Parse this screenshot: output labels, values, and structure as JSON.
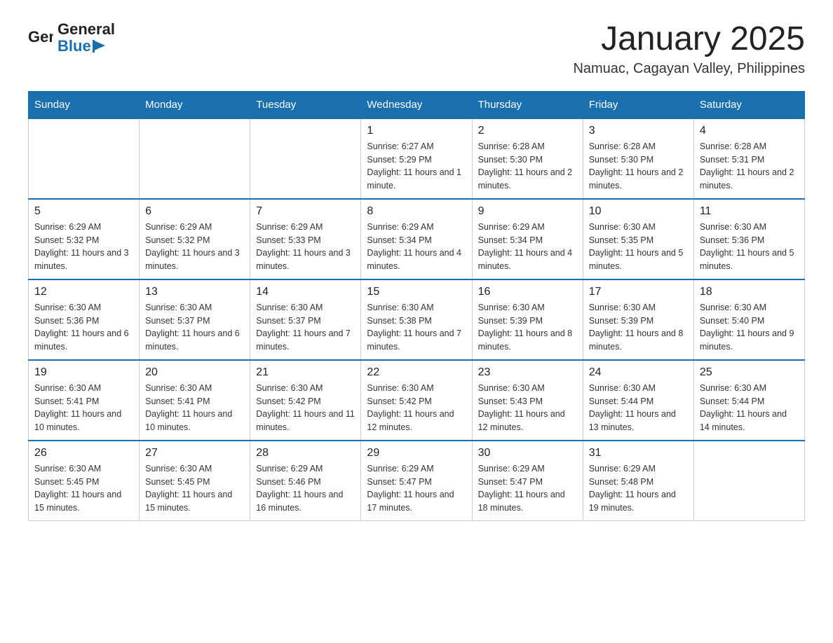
{
  "header": {
    "logo": {
      "text_general": "General",
      "text_blue": "Blue"
    },
    "title": "January 2025",
    "location": "Namuac, Cagayan Valley, Philippines"
  },
  "calendar": {
    "days_of_week": [
      "Sunday",
      "Monday",
      "Tuesday",
      "Wednesday",
      "Thursday",
      "Friday",
      "Saturday"
    ],
    "weeks": [
      [
        {
          "day": "",
          "info": ""
        },
        {
          "day": "",
          "info": ""
        },
        {
          "day": "",
          "info": ""
        },
        {
          "day": "1",
          "info": "Sunrise: 6:27 AM\nSunset: 5:29 PM\nDaylight: 11 hours and 1 minute."
        },
        {
          "day": "2",
          "info": "Sunrise: 6:28 AM\nSunset: 5:30 PM\nDaylight: 11 hours and 2 minutes."
        },
        {
          "day": "3",
          "info": "Sunrise: 6:28 AM\nSunset: 5:30 PM\nDaylight: 11 hours and 2 minutes."
        },
        {
          "day": "4",
          "info": "Sunrise: 6:28 AM\nSunset: 5:31 PM\nDaylight: 11 hours and 2 minutes."
        }
      ],
      [
        {
          "day": "5",
          "info": "Sunrise: 6:29 AM\nSunset: 5:32 PM\nDaylight: 11 hours and 3 minutes."
        },
        {
          "day": "6",
          "info": "Sunrise: 6:29 AM\nSunset: 5:32 PM\nDaylight: 11 hours and 3 minutes."
        },
        {
          "day": "7",
          "info": "Sunrise: 6:29 AM\nSunset: 5:33 PM\nDaylight: 11 hours and 3 minutes."
        },
        {
          "day": "8",
          "info": "Sunrise: 6:29 AM\nSunset: 5:34 PM\nDaylight: 11 hours and 4 minutes."
        },
        {
          "day": "9",
          "info": "Sunrise: 6:29 AM\nSunset: 5:34 PM\nDaylight: 11 hours and 4 minutes."
        },
        {
          "day": "10",
          "info": "Sunrise: 6:30 AM\nSunset: 5:35 PM\nDaylight: 11 hours and 5 minutes."
        },
        {
          "day": "11",
          "info": "Sunrise: 6:30 AM\nSunset: 5:36 PM\nDaylight: 11 hours and 5 minutes."
        }
      ],
      [
        {
          "day": "12",
          "info": "Sunrise: 6:30 AM\nSunset: 5:36 PM\nDaylight: 11 hours and 6 minutes."
        },
        {
          "day": "13",
          "info": "Sunrise: 6:30 AM\nSunset: 5:37 PM\nDaylight: 11 hours and 6 minutes."
        },
        {
          "day": "14",
          "info": "Sunrise: 6:30 AM\nSunset: 5:37 PM\nDaylight: 11 hours and 7 minutes."
        },
        {
          "day": "15",
          "info": "Sunrise: 6:30 AM\nSunset: 5:38 PM\nDaylight: 11 hours and 7 minutes."
        },
        {
          "day": "16",
          "info": "Sunrise: 6:30 AM\nSunset: 5:39 PM\nDaylight: 11 hours and 8 minutes."
        },
        {
          "day": "17",
          "info": "Sunrise: 6:30 AM\nSunset: 5:39 PM\nDaylight: 11 hours and 8 minutes."
        },
        {
          "day": "18",
          "info": "Sunrise: 6:30 AM\nSunset: 5:40 PM\nDaylight: 11 hours and 9 minutes."
        }
      ],
      [
        {
          "day": "19",
          "info": "Sunrise: 6:30 AM\nSunset: 5:41 PM\nDaylight: 11 hours and 10 minutes."
        },
        {
          "day": "20",
          "info": "Sunrise: 6:30 AM\nSunset: 5:41 PM\nDaylight: 11 hours and 10 minutes."
        },
        {
          "day": "21",
          "info": "Sunrise: 6:30 AM\nSunset: 5:42 PM\nDaylight: 11 hours and 11 minutes."
        },
        {
          "day": "22",
          "info": "Sunrise: 6:30 AM\nSunset: 5:42 PM\nDaylight: 11 hours and 12 minutes."
        },
        {
          "day": "23",
          "info": "Sunrise: 6:30 AM\nSunset: 5:43 PM\nDaylight: 11 hours and 12 minutes."
        },
        {
          "day": "24",
          "info": "Sunrise: 6:30 AM\nSunset: 5:44 PM\nDaylight: 11 hours and 13 minutes."
        },
        {
          "day": "25",
          "info": "Sunrise: 6:30 AM\nSunset: 5:44 PM\nDaylight: 11 hours and 14 minutes."
        }
      ],
      [
        {
          "day": "26",
          "info": "Sunrise: 6:30 AM\nSunset: 5:45 PM\nDaylight: 11 hours and 15 minutes."
        },
        {
          "day": "27",
          "info": "Sunrise: 6:30 AM\nSunset: 5:45 PM\nDaylight: 11 hours and 15 minutes."
        },
        {
          "day": "28",
          "info": "Sunrise: 6:29 AM\nSunset: 5:46 PM\nDaylight: 11 hours and 16 minutes."
        },
        {
          "day": "29",
          "info": "Sunrise: 6:29 AM\nSunset: 5:47 PM\nDaylight: 11 hours and 17 minutes."
        },
        {
          "day": "30",
          "info": "Sunrise: 6:29 AM\nSunset: 5:47 PM\nDaylight: 11 hours and 18 minutes."
        },
        {
          "day": "31",
          "info": "Sunrise: 6:29 AM\nSunset: 5:48 PM\nDaylight: 11 hours and 19 minutes."
        },
        {
          "day": "",
          "info": ""
        }
      ]
    ]
  }
}
